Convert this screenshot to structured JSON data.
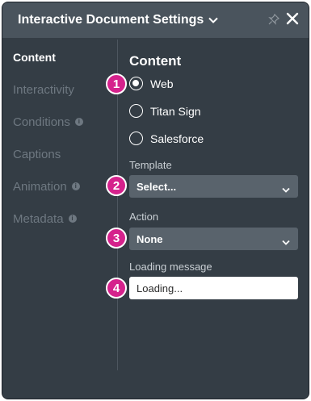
{
  "header": {
    "title": "Interactive Document Settings",
    "icons": {
      "dropdown": "chevron-down-icon",
      "pin": "pin-icon",
      "close": "close-icon"
    }
  },
  "sidebar": {
    "items": [
      {
        "label": "Content",
        "active": true,
        "info": false
      },
      {
        "label": "Interactivity",
        "active": false,
        "info": false
      },
      {
        "label": "Conditions",
        "active": false,
        "info": true
      },
      {
        "label": "Captions",
        "active": false,
        "info": false
      },
      {
        "label": "Animation",
        "active": false,
        "info": true
      },
      {
        "label": "Metadata",
        "active": false,
        "info": true
      }
    ],
    "info_glyph": "i"
  },
  "content": {
    "title": "Content",
    "options": [
      {
        "label": "Web",
        "selected": true
      },
      {
        "label": "Titan Sign",
        "selected": false
      },
      {
        "label": "Salesforce",
        "selected": false
      }
    ],
    "template": {
      "label": "Template",
      "value": "Select..."
    },
    "action": {
      "label": "Action",
      "value": "None"
    },
    "loading": {
      "label": "Loading message",
      "value": "Loading..."
    }
  },
  "badges": [
    "1",
    "2",
    "3",
    "4"
  ],
  "colors": {
    "panel_bg": "#343d45",
    "header_bg": "#4a545d",
    "select_bg": "#59636c",
    "badge": "#d5228c",
    "inactive_text": "#6e7881"
  }
}
